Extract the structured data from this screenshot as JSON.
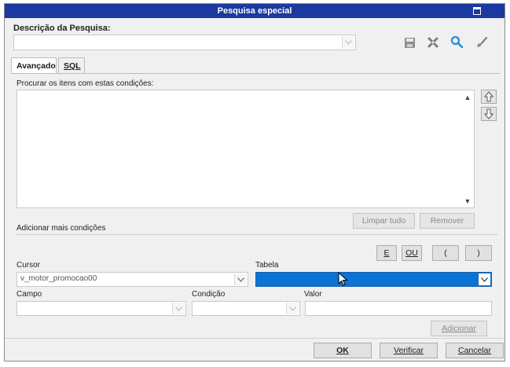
{
  "window": {
    "title": "Pesquisa especial"
  },
  "description": {
    "label": "Descrição da Pesquisa:",
    "value": ""
  },
  "toolbar": {
    "icons": [
      "save-icon",
      "clear-icon",
      "search-icon",
      "brush-icon"
    ]
  },
  "tabs": [
    {
      "label": "Avançado",
      "active": true
    },
    {
      "label": "SQL",
      "active": false
    }
  ],
  "conditions": {
    "label": "Procurar os itens com estas condições:",
    "items": [],
    "clear_all": "Limpar tudo",
    "remove": "Remover"
  },
  "add_more": {
    "label": "Adicionar mais condições",
    "ops": {
      "and": "E",
      "or": "OU",
      "open_paren": "(",
      "close_paren": ")"
    }
  },
  "cursor": {
    "label": "Cursor",
    "value": "v_motor_promocao00"
  },
  "tabela": {
    "label": "Tabela",
    "value": ""
  },
  "campo": {
    "label": "Campo",
    "value": ""
  },
  "condicao": {
    "label": "Condição",
    "value": ""
  },
  "valor": {
    "label": "Valor",
    "value": ""
  },
  "add_button": "Adicionar",
  "footer": {
    "ok": "OK",
    "verify": "Verificar",
    "cancel": "Cancelar"
  },
  "colors": {
    "titlebar": "#1b39a0",
    "selection": "#0a74d6"
  }
}
